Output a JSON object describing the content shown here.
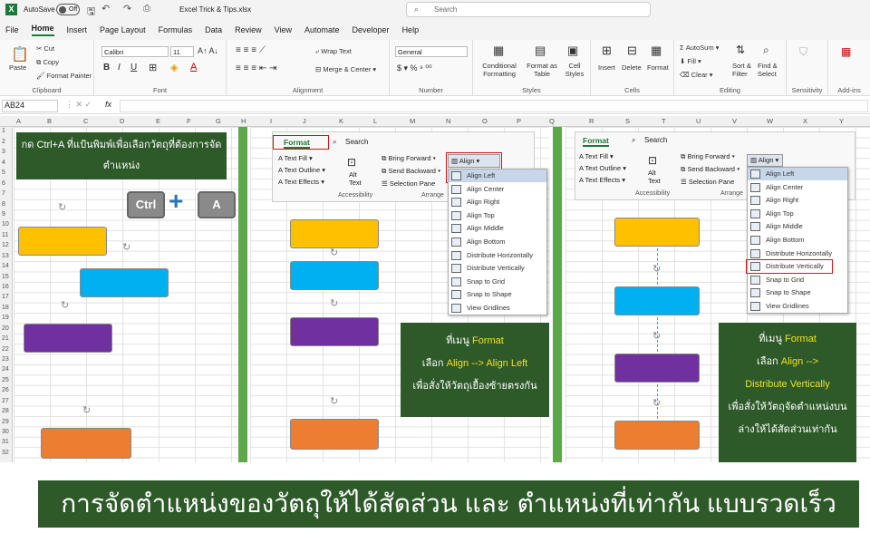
{
  "titlebar": {
    "autosave": "AutoSave",
    "toggle": "Off",
    "filename": "Excel Trick & Tips.xlsx",
    "search": "Search"
  },
  "menu": [
    "File",
    "Home",
    "Insert",
    "Page Layout",
    "Formulas",
    "Data",
    "Review",
    "View",
    "Automate",
    "Developer",
    "Help"
  ],
  "ribbon": {
    "paste": "Paste",
    "cut": "Cut",
    "copy": "Copy",
    "format_painter": "Format Painter",
    "clipboard": "Clipboard",
    "font_name": "Calibri",
    "font_size": "11",
    "font_group": "Font",
    "wrap_text": "Wrap Text",
    "merge_center": "Merge & Center",
    "alignment": "Alignment",
    "number_format": "General",
    "number": "Number",
    "cond_fmt": "Conditional Formatting",
    "fmt_table": "Format as Table",
    "cell_styles": "Cell Styles",
    "styles": "Styles",
    "insert": "Insert",
    "delete": "Delete",
    "format": "Format",
    "cells": "Cells",
    "autosum": "AutoSum",
    "fill": "Fill",
    "clear": "Clear",
    "sort_filter": "Sort & Filter",
    "find_select": "Find & Select",
    "editing": "Editing",
    "sensitivity": "Sensitivity",
    "addins": "Add-ins"
  },
  "namebox": "AB24",
  "fx": "fx",
  "cols": [
    "A",
    "B",
    "C",
    "D",
    "E",
    "F",
    "G",
    "H",
    "I",
    "J",
    "K",
    "L",
    "M",
    "N",
    "O",
    "P",
    "Q",
    "R",
    "S",
    "T",
    "U",
    "V",
    "W",
    "X",
    "Y"
  ],
  "rows": [
    "1",
    "2",
    "3",
    "4",
    "5",
    "6",
    "7",
    "8",
    "9",
    "10",
    "11",
    "12",
    "13",
    "14",
    "15",
    "16",
    "17",
    "18",
    "19",
    "20",
    "21",
    "22",
    "23",
    "24",
    "25",
    "26",
    "27",
    "28",
    "29",
    "30",
    "31",
    "32"
  ],
  "panel1": {
    "caption": "กด Ctrl+A ที่แป้นพิมพ์เพื่อเลือกวัตถุที่ต้องการจัดตำแหน่ง",
    "key1": "Ctrl",
    "plus": "+",
    "key2": "A"
  },
  "panel2": {
    "tab": "Format",
    "search": "Search",
    "text_fill": "Text Fill",
    "text_outline": "Text Outline",
    "text_effects": "Text Effects",
    "alt_text": "Alt Text",
    "accessibility": "Accessibility",
    "bring_forward": "Bring Forward",
    "send_backward": "Send Backward",
    "selection_pane": "Selection Pane",
    "arrange": "Arrange",
    "align": "Align",
    "menu": [
      "Align Left",
      "Align Center",
      "Align Right",
      "Align Top",
      "Align Middle",
      "Align Bottom",
      "Distribute Horizontally",
      "Distribute Vertically",
      "Snap to Grid",
      "Snap to Shape",
      "View Gridlines"
    ],
    "note1": "ที่เมนู",
    "note1b": "Format",
    "note2": "เลือก",
    "note2b": "Align",
    "note2c": "-->",
    "note2d": "Align Left",
    "note3": "เพื่อสั่งให้วัตถุเยื้องซ้ายตรงกัน"
  },
  "panel3": {
    "tab": "Format",
    "search": "Search",
    "text_fill": "Text Fill",
    "text_outline": "Text Outline",
    "text_effects": "Text Effects",
    "alt_text": "Alt Text",
    "accessibility": "Accessibility",
    "bring_forward": "Bring Forward",
    "send_backward": "Send Backward",
    "selection_pane": "Selection Pane",
    "arrange": "Arrange",
    "align": "Align",
    "menu": [
      "Align Left",
      "Align Center",
      "Align Right",
      "Align Top",
      "Align Middle",
      "Align Bottom",
      "Distribute Horizontally",
      "Distribute Vertically",
      "Snap to Grid",
      "Snap to Shape",
      "View Gridlines"
    ],
    "note1": "ที่เมนู",
    "note1b": "Format",
    "note2": "เลือก",
    "note2b": "Align",
    "note2c": "-->",
    "note3": "Distribute Vertically",
    "note4": "เพื่อสั่งให้วัตถุจัดตำแหน่งบน",
    "note5": "ล่างให้ได้สัดส่วนเท่ากัน"
  },
  "banner": "การจัดตำแหน่งของวัตถุให้ได้สัดส่วน และ ตำแหน่งที่เท่ากัน แบบรวดเร็ว",
  "colors": {
    "yellow": "#ffc000",
    "blue": "#00b0f0",
    "purple": "#7030a0",
    "orange": "#ed7d31",
    "dark_green": "#2e5a2a",
    "accent_green": "#1a7a3a"
  }
}
